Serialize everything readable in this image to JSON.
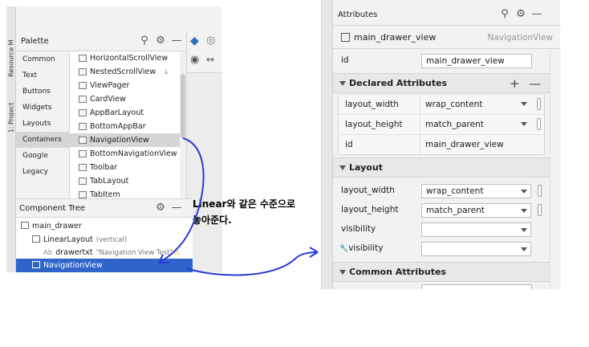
{
  "left_panel": {
    "side_tabs": [
      "Resource M",
      "1: Project"
    ],
    "palette": {
      "title": "Palette",
      "categories": [
        "Common",
        "Text",
        "Buttons",
        "Widgets",
        "Layouts",
        "Containers",
        "Google",
        "Legacy"
      ],
      "selected_category": "Containers",
      "items": [
        "HorizontalScrollView",
        "NestedScrollView",
        "ViewPager",
        "CardView",
        "AppBarLayout",
        "BottomAppBar",
        "NavigationView",
        "BottomNavigationView",
        "Toolbar",
        "TabLayout",
        "TabItem"
      ],
      "selected_item": "NavigationView"
    },
    "component_tree": {
      "title": "Component Tree",
      "nodes": [
        {
          "label": "main_drawer",
          "detail": ""
        },
        {
          "label": "LinearLayout",
          "detail": "(vertical)"
        },
        {
          "label": "drawertxt",
          "detail": "\"Navigation View Test\"",
          "prefix": "Ab"
        },
        {
          "label": "NavigationView",
          "detail": ""
        }
      ]
    }
  },
  "annotation": {
    "line1": "Linear와 같은 수준으로",
    "line2": "놓아준다."
  },
  "attributes_panel": {
    "title": "Attributes",
    "component_name": "main_drawer_view",
    "component_type": "NavigationView",
    "id_label": "id",
    "id_value": "main_drawer_view",
    "declared": {
      "title": "Declared Attributes",
      "rows": [
        {
          "label": "layout_width",
          "value": "wrap_content"
        },
        {
          "label": "layout_height",
          "value": "match_parent"
        },
        {
          "label": "id",
          "value": "main_drawer_view"
        }
      ]
    },
    "layout": {
      "title": "Layout",
      "rows": [
        {
          "label": "layout_width",
          "value": "wrap_content"
        },
        {
          "label": "layout_height",
          "value": "match_parent"
        },
        {
          "label": "visibility",
          "value": ""
        },
        {
          "label": "visibility",
          "value": ""
        }
      ]
    },
    "common": {
      "title": "Common Attributes"
    }
  },
  "colors": {
    "selection_blue": "#2f65ca",
    "highlight_yellow": "#f7f722",
    "annotation_line": "#2b3bd6"
  }
}
